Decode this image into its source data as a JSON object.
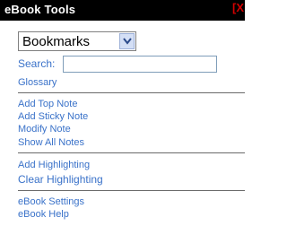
{
  "window": {
    "title": "eBook Tools",
    "close_label": "[X"
  },
  "selector": {
    "selected": "Bookmarks"
  },
  "search": {
    "label": "Search:",
    "value": "",
    "placeholder": ""
  },
  "links": {
    "glossary": "Glossary",
    "add_top_note": "Add Top Note",
    "add_sticky_note": "Add Sticky Note",
    "modify_note": "Modify Note",
    "show_all_notes": "Show All Notes",
    "add_highlighting": "Add Highlighting",
    "clear_highlighting": "Clear Highlighting",
    "ebook_settings": "eBook Settings",
    "ebook_help": "eBook Help"
  },
  "colors": {
    "title_bg": "#000000",
    "title_text": "#ffffff",
    "close": "#d40000",
    "link": "#3a72c9"
  }
}
